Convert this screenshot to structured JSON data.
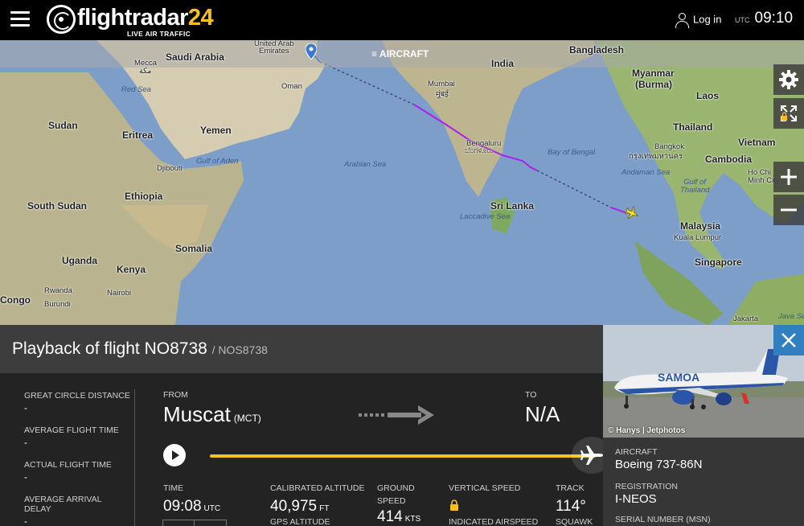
{
  "header": {
    "logo_main": "flightradar",
    "logo_num": "24",
    "logo_sub": "LIVE AIR TRAFFIC",
    "login_label": "Log in",
    "utc_label": "UTC",
    "time": "09:10"
  },
  "map": {
    "aircraft_toggle": "AIRCRAFT",
    "labels": {
      "saudi_arabia": "Saudi Arabia",
      "mecca": "Mecca",
      "mecca_native": "مكة",
      "uae": "United Arab",
      "uae2": "Emirates",
      "oman": "Oman",
      "red_sea": "Red Sea",
      "india": "India",
      "bangladesh": "Bangladesh",
      "myanmar": "Myanmar",
      "burma": "(Burma)",
      "laos": "Laos",
      "mumbai": "Mumbai",
      "mumbai_native": "मुंबई",
      "sudan": "Sudan",
      "eritrea": "Eritrea",
      "yemen": "Yemen",
      "thailand": "Thailand",
      "vietnam": "Vietnam",
      "bengaluru": "Bengaluru",
      "bengaluru_native": "ಬೆಂಗಳೂರು",
      "bay_of_bengal": "Bay of Bengal",
      "bangkok": "Bangkok",
      "bangkok_native": "กรุงเทพมหานคร",
      "cambodia": "Cambodia",
      "gulf_of_aden": "Gulf of Aden",
      "djibouti": "Djibouti",
      "arabian_sea": "Arabian Sea",
      "andaman_sea": "Andaman Sea",
      "ho_chi_minh": "Ho Chi",
      "ho_chi_minh2": "Minh City",
      "gulf_thailand": "Gulf of",
      "gulf_thailand2": "Thailand",
      "ethiopia": "Ethiopia",
      "south_sudan": "South Sudan",
      "sri_lanka": "Sri Lanka",
      "laccadive_sea": "Laccadive Sea",
      "malaysia": "Malaysia",
      "kuala_lumpur": "Kuala Lumpur",
      "somalia": "Somalia",
      "singapore": "Singapore",
      "uganda": "Uganda",
      "kenya": "Kenya",
      "rwanda": "Rwanda",
      "nairobi": "Nairobi",
      "burundi": "Burundi",
      "congo": "Congo",
      "jakarta": "Jakarta",
      "java_sea": "Java Se"
    }
  },
  "flight": {
    "title": "Playback of flight NO8738",
    "callsign": "/ NOS8738",
    "stats": [
      {
        "label": "GREAT CIRCLE DISTANCE",
        "value": "-"
      },
      {
        "label": "AVERAGE FLIGHT TIME",
        "value": "-"
      },
      {
        "label": "ACTUAL FLIGHT TIME",
        "value": "-"
      },
      {
        "label": "AVERAGE ARRIVAL",
        "label2": "DELAY",
        "value": "-"
      }
    ],
    "from_label": "FROM",
    "from_city": "Muscat",
    "from_code": "(MCT)",
    "to_label": "TO",
    "to_city": "N/A",
    "metrics": {
      "time_label": "TIME",
      "time_value": "09:08",
      "time_unit": "UTC",
      "cal_alt_label": "CALIBRATED ALTITUDE",
      "cal_alt_value": "40,975",
      "cal_alt_unit": "FT",
      "gps_alt_label": "GPS ALTITUDE",
      "ground_speed_label": "GROUND",
      "ground_speed_label2": "SPEED",
      "ground_speed_value": "414",
      "ground_speed_unit": "KTS",
      "vertical_speed_label": "VERTICAL SPEED",
      "indicated_airspeed_label": "INDICATED AIRSPEED",
      "track_label": "TRACK",
      "track_value": "114°",
      "squawk_label": "SQUAWK"
    }
  },
  "aircraft": {
    "photo_livery": "SAMOA",
    "photo_credit": "© Hanys | Jetphotos",
    "aircraft_label": "AIRCRAFT",
    "aircraft_value": "Boeing 737-86N",
    "registration_label": "REGISTRATION",
    "registration_value": "I-NEOS",
    "serial_label": "SERIAL NUMBER (MSN)"
  }
}
